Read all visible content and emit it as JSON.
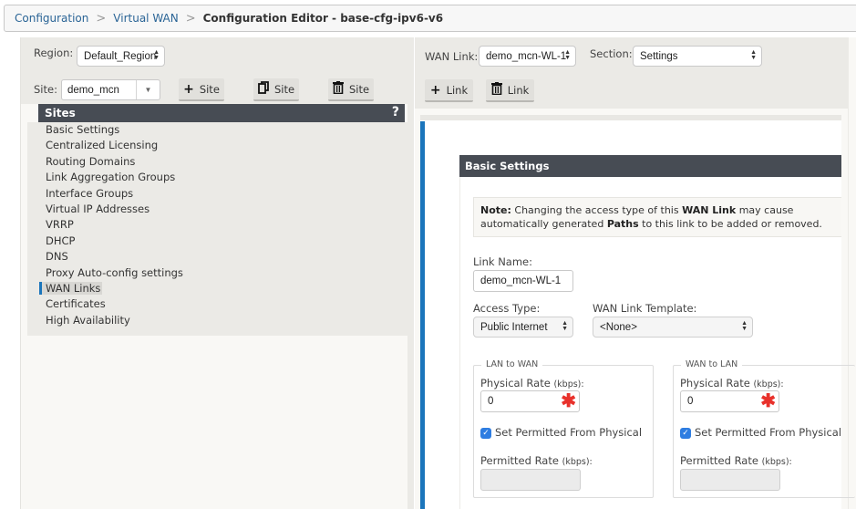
{
  "breadcrumb": {
    "items": [
      "Configuration",
      "Virtual WAN"
    ],
    "current": "Configuration Editor - base-cfg-ipv6-v6",
    "separator": ">"
  },
  "left": {
    "region_label": "Region:",
    "region_value": "Default_Region",
    "site_label": "Site:",
    "site_value": "demo_mcn",
    "buttons": {
      "add_site": {
        "icon": "+",
        "label": "Site"
      },
      "clone_site": {
        "icon": "⧉",
        "label": "Site"
      },
      "delete_site": {
        "icon": "🗑",
        "label": "Site"
      }
    },
    "sites_header": "Sites",
    "help": "?",
    "sites_items": [
      "Basic Settings",
      "Centralized Licensing",
      "Routing Domains",
      "Link Aggregation Groups",
      "Interface Groups",
      "Virtual IP Addresses",
      "VRRP",
      "DHCP",
      "DNS",
      "Proxy Auto-config settings",
      "WAN Links",
      "Certificates",
      "High Availability"
    ],
    "active_item": "WAN Links"
  },
  "right": {
    "wan_link_label": "WAN Link:",
    "wan_link_value": "demo_mcn-WL-1",
    "section_label": "Section:",
    "section_value": "Settings",
    "buttons": {
      "add_link": {
        "icon": "+",
        "label": "Link"
      },
      "delete_link": {
        "icon": "🗑",
        "label": "Link"
      }
    },
    "basic_settings": {
      "header": "Basic Settings",
      "note_prefix": "Note:",
      "note_text_1": " Changing the access type of this ",
      "note_bold_1": "WAN Link",
      "note_text_2": " may cause automatically generated ",
      "note_bold_2": "Paths",
      "note_text_3": " to this link to be added or removed.",
      "link_name_label": "Link Name:",
      "link_name_value": "demo_mcn-WL-1",
      "access_type_label": "Access Type:",
      "access_type_value": "Public Internet",
      "template_label": "WAN Link Template:",
      "template_value": "<None>",
      "lan_to_wan": {
        "legend": "LAN to WAN",
        "physical_rate_label": "Physical Rate",
        "unit": "(kbps):",
        "physical_rate_value": "0",
        "checkbox_label": "Set Permitted From Physical",
        "checked": true,
        "permitted_rate_label": "Permitted Rate",
        "permitted_rate_value": ""
      },
      "wan_to_lan": {
        "legend": "WAN to LAN",
        "physical_rate_label": "Physical Rate",
        "unit": "(kbps):",
        "physical_rate_value": "0",
        "checkbox_label": "Set Permitted From Physical",
        "checked": true,
        "permitted_rate_label": "Permitted Rate",
        "permitted_rate_value": ""
      }
    }
  },
  "colors": {
    "accent_blue": "#1b75bb",
    "header_dark": "#474c54",
    "required_red": "#e8312b",
    "link_blue": "#2a6496"
  }
}
